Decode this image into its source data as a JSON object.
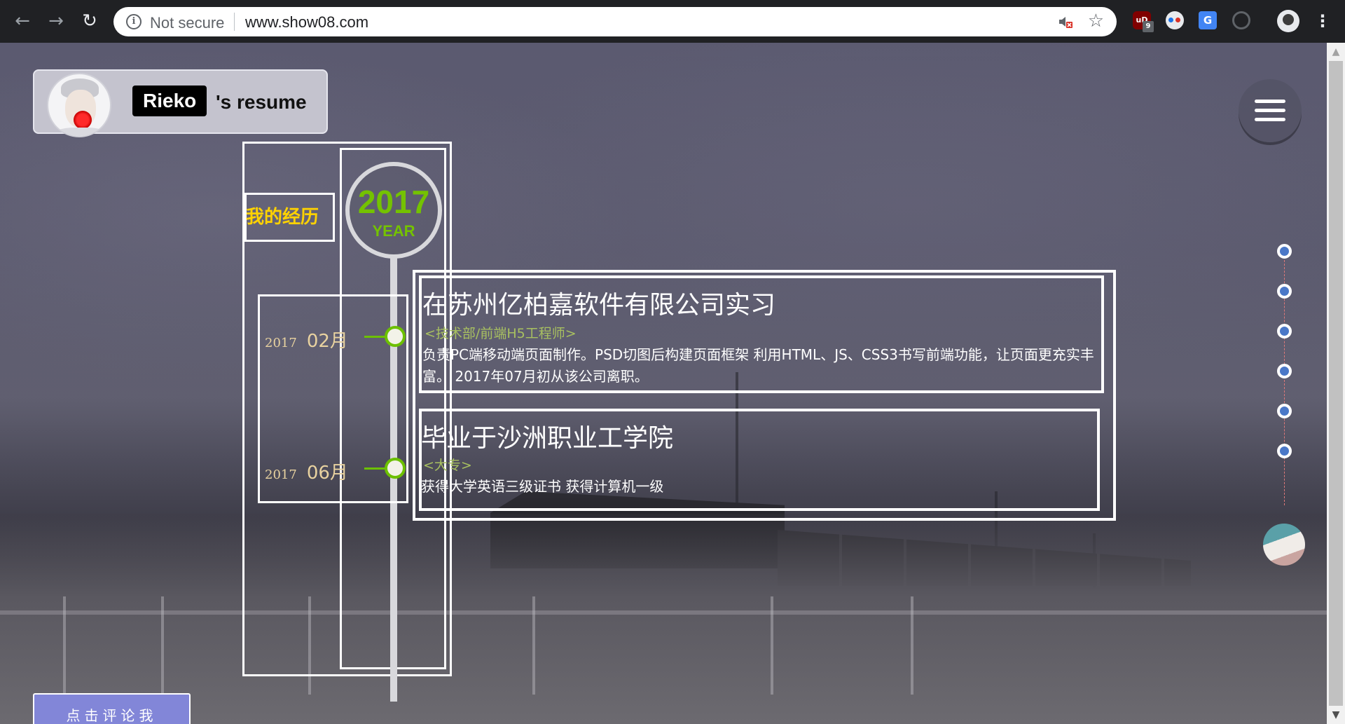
{
  "browser": {
    "back_icon": "arrow-left-icon",
    "forward_icon": "arrow-right-icon",
    "reload_icon": "reload-icon",
    "security_label": "Not secure",
    "url": "www.show08.com",
    "ublock_badge": "9",
    "ublock_label": "uD",
    "translate_label": "G"
  },
  "header": {
    "name": "Rieko",
    "suffix": "'s resume"
  },
  "timeline": {
    "title": "我的经历",
    "year": "2017",
    "year_label": "YEAR",
    "entries": [
      {
        "year": "2017",
        "month": "02月"
      },
      {
        "year": "2017",
        "month": "06月"
      }
    ]
  },
  "experiences": [
    {
      "title": "在苏州亿柏嘉软件有限公司实习",
      "role": "<技术部/前端H5工程师>",
      "description": "负责PC端移动端页面制作。PSD切图后构建页面框架 利用HTML、JS、CSS3书写前端功能，让页面更充实丰富。 2017年07月初从该公司离职。"
    },
    {
      "title": "毕业于沙洲职业工学院",
      "role": "<大专>",
      "description": "获得大学英语三级证书 获得计算机一级"
    }
  ],
  "comment_button": "点击评论我",
  "colors": {
    "accent_green": "#74c200",
    "title_yellow": "#ffd200",
    "comment_button": "#8286d8",
    "side_dot": "#4a78c8"
  }
}
